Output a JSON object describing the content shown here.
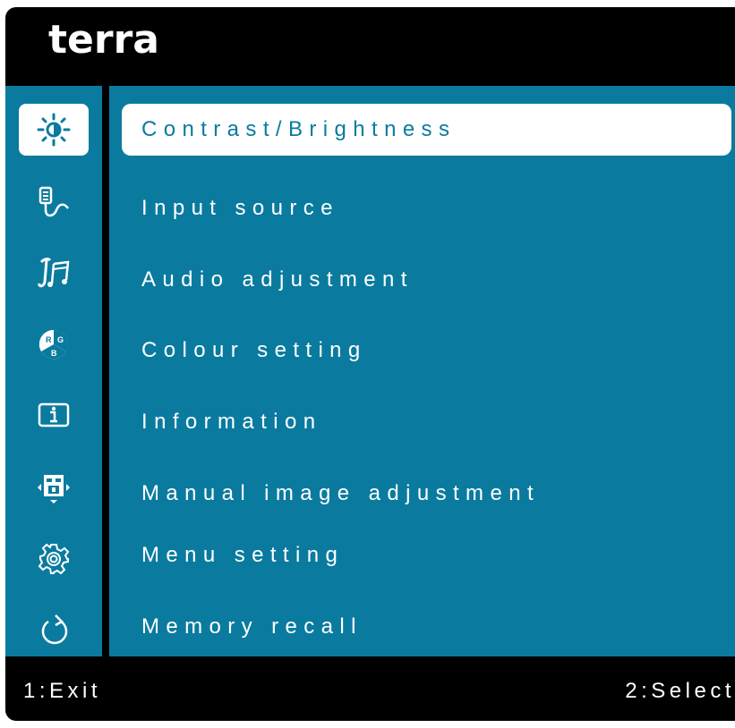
{
  "header": {
    "brand": "terra"
  },
  "colors": {
    "accent": "#0a7b9f",
    "frame": "#000000",
    "highlight": "#ffffff"
  },
  "menu": {
    "items": [
      {
        "label": "Contrast/Brightness",
        "icon": "brightness-icon",
        "selected": true
      },
      {
        "label": "Input source",
        "icon": "input-source-icon",
        "selected": false
      },
      {
        "label": "Audio adjustment",
        "icon": "audio-icon",
        "selected": false
      },
      {
        "label": "Colour setting",
        "icon": "rgb-color-icon",
        "selected": false
      },
      {
        "label": "Information",
        "icon": "info-icon",
        "selected": false
      },
      {
        "label": "Manual image adjustment",
        "icon": "image-adjust-icon",
        "selected": false
      },
      {
        "label": "Menu setting",
        "icon": "gear-icon",
        "selected": false
      },
      {
        "label": "Memory recall",
        "icon": "reset-icon",
        "selected": false
      }
    ]
  },
  "footer": {
    "exit": "1:Exit",
    "select": "2:Select"
  }
}
